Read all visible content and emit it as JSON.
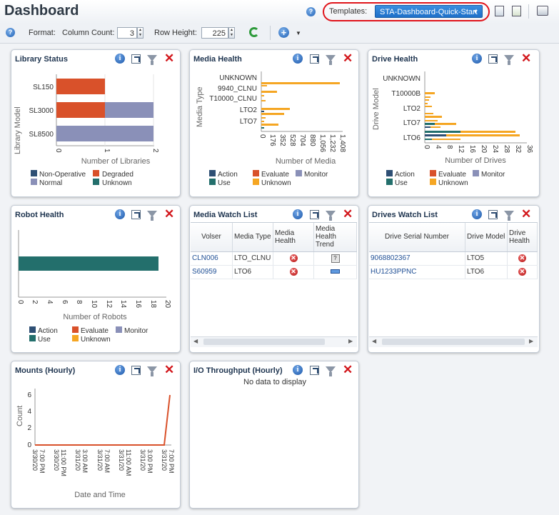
{
  "header": {
    "title": "Dashboard",
    "help_icon": "?",
    "templates_label": "Templates:",
    "template_value": "STA-Dashboard-Quick-Start"
  },
  "toolbar": {
    "format_label": "Format:",
    "column_count_label": "Column Count:",
    "column_count": "3",
    "row_height_label": "Row Height:",
    "row_height": "225"
  },
  "panels": {
    "library_status": {
      "title": "Library Status"
    },
    "media_health": {
      "title": "Media Health"
    },
    "drive_health": {
      "title": "Drive Health"
    },
    "robot_health": {
      "title": "Robot Health"
    },
    "media_watch": {
      "title": "Media Watch List"
    },
    "drives_watch": {
      "title": "Drives Watch List"
    },
    "mounts": {
      "title": "Mounts (Hourly)"
    },
    "io": {
      "title": "I/O Throughput (Hourly)",
      "empty": "No data to display"
    }
  },
  "colors": {
    "non_operative": "#2e4f74",
    "degraded": "#d9512a",
    "normal": "#8a90b8",
    "unknown": "#236f6c",
    "action": "#2e4f74",
    "evaluate": "#d9512a",
    "monitor": "#8a90b8",
    "use": "#236f6c",
    "unknown_orange": "#f5a623"
  },
  "chart_data": [
    {
      "type": "bar",
      "orientation": "horizontal",
      "stacked": true,
      "title": "Library Status",
      "ylabel": "Library Model",
      "xlabel": "Number of Libraries",
      "categories": [
        "SL150",
        "SL3000",
        "SL8500"
      ],
      "xlim": [
        0,
        2
      ],
      "x_ticks": [
        "0",
        "1",
        "2"
      ],
      "series": [
        {
          "name": "Degraded",
          "values": [
            1,
            1,
            0
          ]
        },
        {
          "name": "Normal",
          "values": [
            0,
            1,
            2
          ]
        }
      ],
      "legend": [
        "Non-Operative",
        "Degraded",
        "Normal",
        "Unknown"
      ],
      "legend_position": "bottom"
    },
    {
      "type": "bar",
      "orientation": "horizontal",
      "stacked": true,
      "title": "Media Health",
      "ylabel": "Media Type",
      "xlabel": "Number of Media",
      "categories": [
        "UNKNOWN",
        "9940_CLNU",
        "T10000_CLNU",
        "LTO2",
        "LTO7"
      ],
      "x_ticks": [
        "0",
        "176",
        "352",
        "528",
        "704",
        "880",
        "1,056",
        "1,232",
        "1,408"
      ],
      "legend": [
        "Action",
        "Evaluate",
        "Monitor",
        "Use",
        "Unknown"
      ],
      "legend_position": "bottom"
    },
    {
      "type": "bar",
      "orientation": "horizontal",
      "stacked": true,
      "title": "Drive Health",
      "ylabel": "Drive Model",
      "xlabel": "Number of Drives",
      "categories": [
        "UNKNOWN",
        "T10000B",
        "LTO2",
        "LTO7",
        "LTO6"
      ],
      "x_ticks": [
        "0",
        "4",
        "8",
        "12",
        "16",
        "20",
        "24",
        "28",
        "32",
        "36"
      ],
      "legend": [
        "Action",
        "Evaluate",
        "Monitor",
        "Use",
        "Unknown"
      ],
      "legend_position": "bottom"
    },
    {
      "type": "bar",
      "orientation": "horizontal",
      "title": "Robot Health",
      "xlabel": "Number of Robots",
      "series": [
        {
          "name": "Use",
          "values": [
            19
          ]
        }
      ],
      "xlim": [
        0,
        20
      ],
      "x_ticks": [
        "0",
        "2",
        "4",
        "6",
        "8",
        "10",
        "12",
        "14",
        "16",
        "18",
        "20"
      ],
      "legend": [
        "Action",
        "Evaluate",
        "Monitor",
        "Use",
        "Unknown"
      ],
      "legend_position": "bottom"
    },
    {
      "type": "line",
      "title": "Mounts (Hourly)",
      "ylabel": "Count",
      "xlabel": "Date and Time",
      "ylim": [
        0,
        6
      ],
      "y_ticks": [
        "0",
        "2",
        "4",
        "6"
      ],
      "x": [
        "3/30/20 7:00 PM",
        "3/30/20 11:00 PM",
        "3/31/20 3:00 AM",
        "3/31/20 7:00 AM",
        "3/31/20 11:00 AM",
        "3/31/20 3:00 PM",
        "3/31/20 7:00 PM"
      ],
      "series": [
        {
          "values": [
            0,
            0,
            0,
            0,
            0,
            0,
            6
          ]
        }
      ]
    }
  ],
  "media_watch": {
    "columns": [
      "Volser",
      "Media Type",
      "Media Health",
      "Media Health Trend"
    ],
    "rows": [
      {
        "volser": "CLN006",
        "type": "LTO_CLNU"
      },
      {
        "volser": "S60959",
        "type": "LTO6"
      }
    ]
  },
  "drives_watch": {
    "columns": [
      "Drive Serial Number",
      "Drive Model",
      "Drive Health"
    ],
    "rows": [
      {
        "serial": "9068802367",
        "model": "LTO5"
      },
      {
        "serial": "HU1233PPNC",
        "model": "LTO6"
      }
    ]
  }
}
